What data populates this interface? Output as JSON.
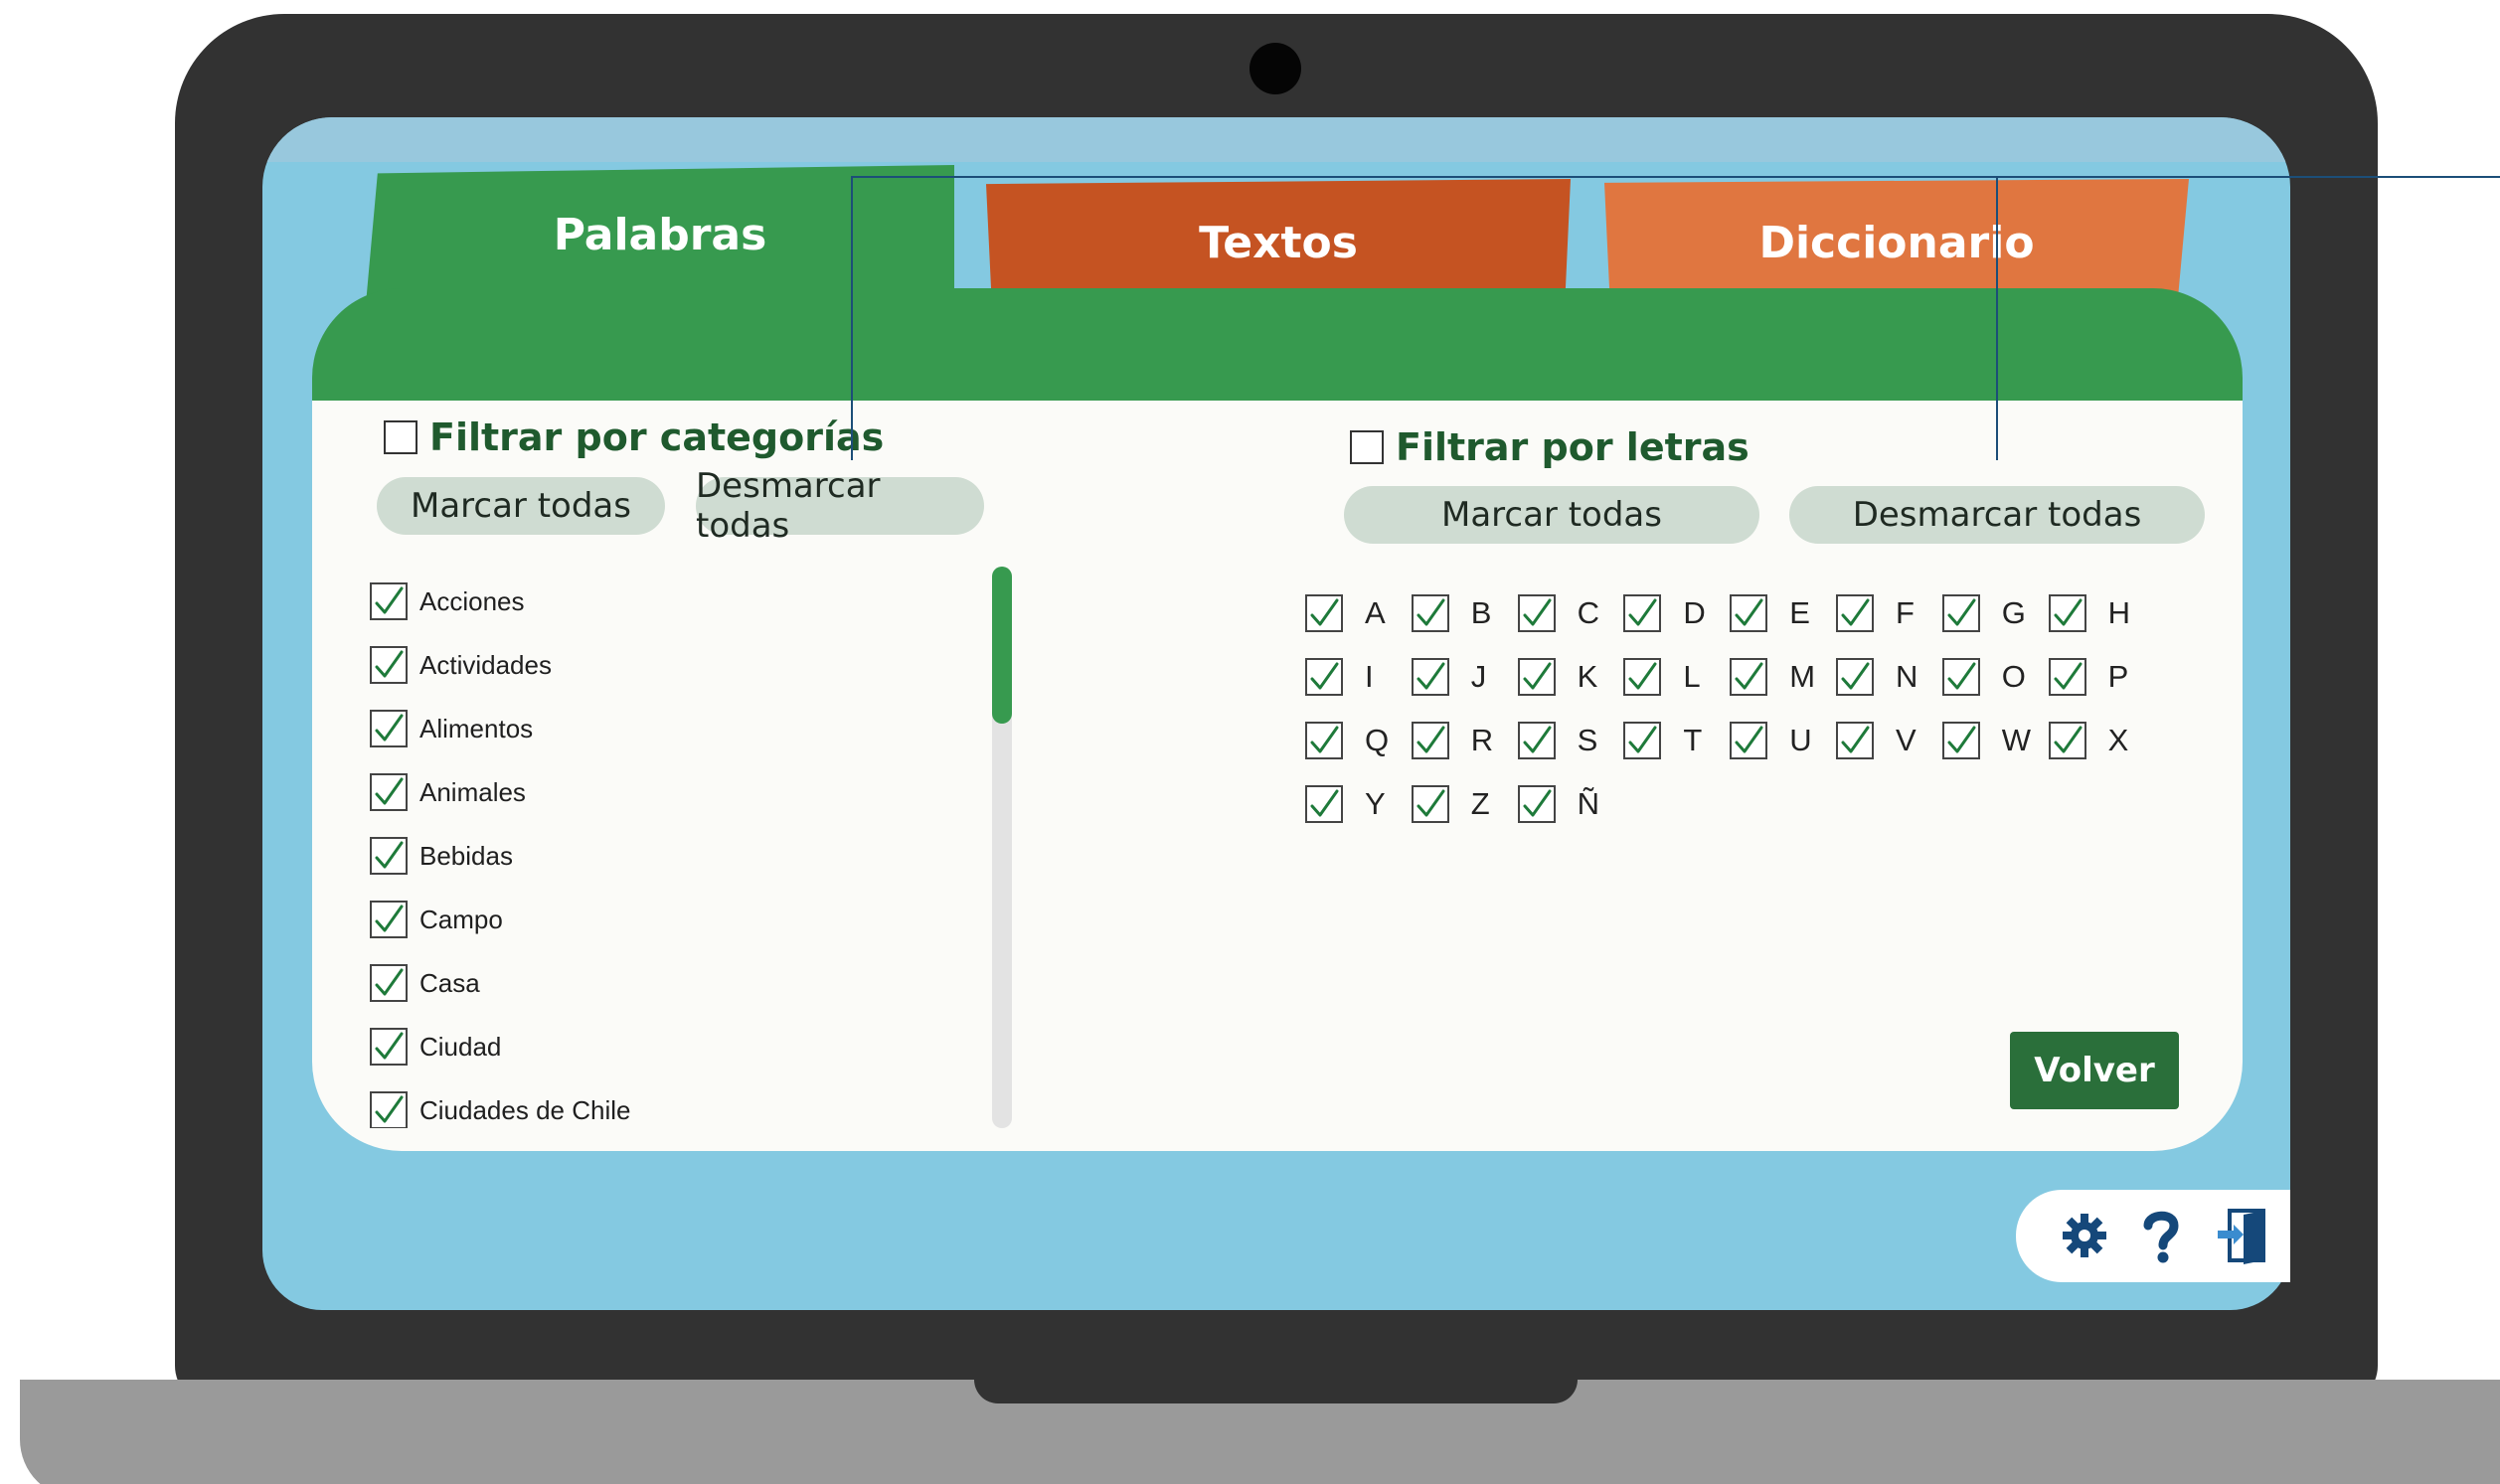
{
  "tabs": [
    {
      "label": "Palabras",
      "color": "#379a4f",
      "active": true
    },
    {
      "label": "Textos",
      "color": "#c55322",
      "active": false
    },
    {
      "label": "Diccionario",
      "color": "#e07640",
      "active": false
    }
  ],
  "categories_filter": {
    "title": "Filtrar por categorías",
    "checked": false,
    "select_all": "Marcar todas",
    "deselect_all": "Desmarcar todas",
    "items": [
      {
        "label": "Acciones",
        "checked": true
      },
      {
        "label": "Actividades",
        "checked": true
      },
      {
        "label": "Alimentos",
        "checked": true
      },
      {
        "label": "Animales",
        "checked": true
      },
      {
        "label": "Bebidas",
        "checked": true
      },
      {
        "label": "Campo",
        "checked": true
      },
      {
        "label": "Casa",
        "checked": true
      },
      {
        "label": "Ciudad",
        "checked": true
      },
      {
        "label": "Ciudades de Chile",
        "checked": true
      }
    ]
  },
  "letters_filter": {
    "title": "Filtrar por letras",
    "checked": false,
    "select_all": "Marcar todas",
    "deselect_all": "Desmarcar todas",
    "letters": [
      "A",
      "B",
      "C",
      "D",
      "E",
      "F",
      "G",
      "H",
      "I",
      "J",
      "K",
      "L",
      "M",
      "N",
      "O",
      "P",
      "Q",
      "R",
      "S",
      "T",
      "U",
      "V",
      "W",
      "X",
      "Y",
      "Z",
      "Ñ"
    ]
  },
  "actions": {
    "back": "Volver"
  },
  "toolbar": {
    "icons": [
      "gear-icon",
      "help-icon",
      "exit-door-icon"
    ],
    "icon_color": "#15487a"
  },
  "colors": {
    "accent": "#379a4f",
    "check": "#1e7a3a"
  }
}
